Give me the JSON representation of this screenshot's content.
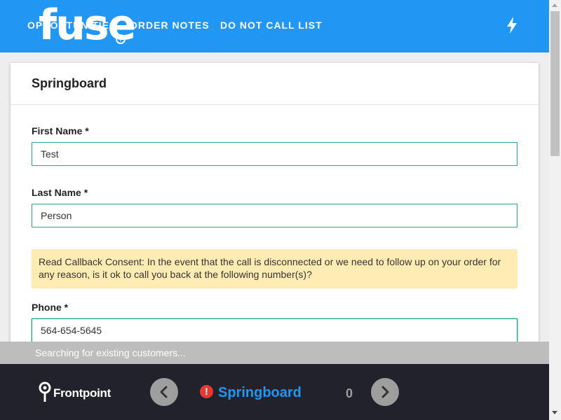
{
  "header": {
    "logo_text": "fuse",
    "nav": {
      "opportunities": "OPPORTUNITIES",
      "order_notes": "ORDER NOTES",
      "do_not_call": "DO NOT CALL LIST"
    },
    "help_glyph": "?",
    "icons": [
      "help-icon",
      "lightning-bolt-icon"
    ]
  },
  "card": {
    "title": "Springboard",
    "first_name": {
      "label": "First Name *",
      "value": "Test"
    },
    "last_name": {
      "label": "Last Name *",
      "value": "Person"
    },
    "consent_notice": "Read Callback Consent: In the event that the call is disconnected or we need to follow up on your order for any reason, is it ok to call you back at the following number(s)?",
    "phone": {
      "label": "Phone *",
      "value": "564-654-5645"
    }
  },
  "status": {
    "text": "Searching for existing customers..."
  },
  "footer": {
    "brand": "Frontpoint",
    "step_title": "Springboard",
    "alert_glyph": "!",
    "counter": "0"
  },
  "colors": {
    "header_blue": "#2196f3",
    "footer_dark": "#22222d",
    "input_border": "#26a69a",
    "notice_bg": "#ffecb3",
    "alert_red": "#e53935"
  }
}
